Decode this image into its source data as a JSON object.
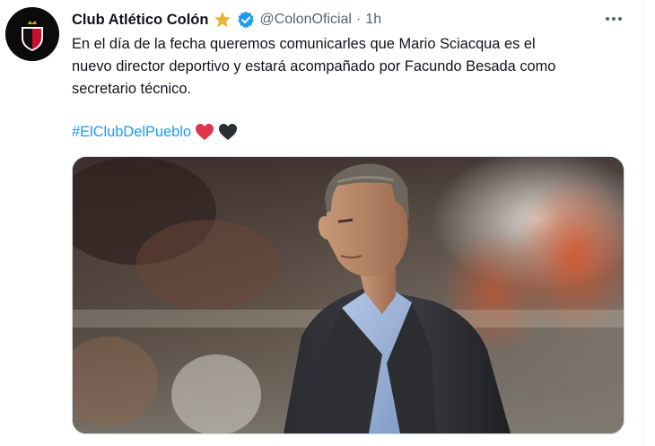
{
  "tweet": {
    "display_name": "Club Atlético Colón",
    "handle": "@ColonOficial",
    "separator": "·",
    "time": "1h",
    "text_lines": [
      "En el día de la fecha queremos comunicarles que Mario Sciacqua es el",
      "nuevo director deportivo y estará acompañado por Facundo Besada como",
      "secretario técnico."
    ],
    "hashtag": "#ElClubDelPueblo",
    "icons": {
      "avatar": "club-crest-icon",
      "gold_badge": "gold-star-badge-icon",
      "verified": "verified-check-icon",
      "more": "more-options-icon",
      "red_heart": "red-heart-icon",
      "black_heart": "black-heart-icon"
    },
    "colors": {
      "link": "#1d9bf0",
      "text": "#0f1419",
      "secondary": "#536471",
      "red_heart": "#e0344e",
      "black_heart": "#292f33",
      "gold": "#e8b530",
      "verified": "#1d9bf0"
    }
  }
}
